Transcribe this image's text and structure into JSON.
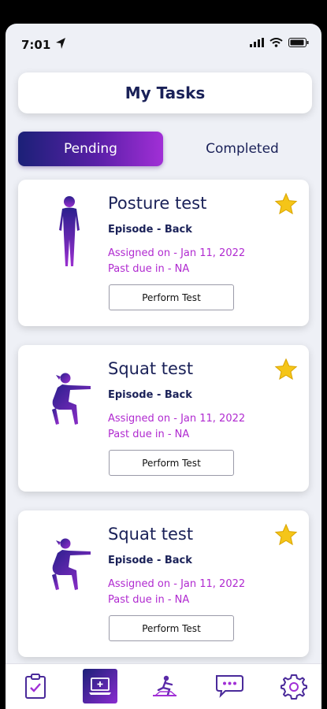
{
  "status_bar": {
    "time": "7:01"
  },
  "header": {
    "title": "My Tasks"
  },
  "tabs": [
    {
      "label": "Pending",
      "active": true
    },
    {
      "label": "Completed",
      "active": false
    }
  ],
  "tasks": [
    {
      "title": "Posture test",
      "episode": "Episode - Back",
      "assigned": "Assigned on - Jan 11, 2022",
      "past_due": "Past due in - NA",
      "button": "Perform Test",
      "figure": "standing-person-icon",
      "starred": true
    },
    {
      "title": "Squat test",
      "episode": "Episode - Back",
      "assigned": "Assigned on - Jan 11, 2022",
      "past_due": "Past due in - NA",
      "button": "Perform Test",
      "figure": "squatting-person-icon",
      "starred": true
    },
    {
      "title": "Squat test",
      "episode": "Episode - Back",
      "assigned": "Assigned on - Jan 11, 2022",
      "past_due": "Past due in - NA",
      "button": "Perform Test",
      "figure": "squatting-person-icon",
      "starred": true
    }
  ],
  "bottom_nav": [
    {
      "icon": "clipboard-check-icon",
      "active": false
    },
    {
      "icon": "laptop-plus-icon",
      "active": true
    },
    {
      "icon": "exercise-icon",
      "active": false
    },
    {
      "icon": "chat-bubbles-icon",
      "active": false
    },
    {
      "icon": "gear-icon",
      "active": false
    }
  ],
  "colors": {
    "navy": "#1a2158",
    "accent_purple": "#b02ad0",
    "star": "#f5c518"
  }
}
